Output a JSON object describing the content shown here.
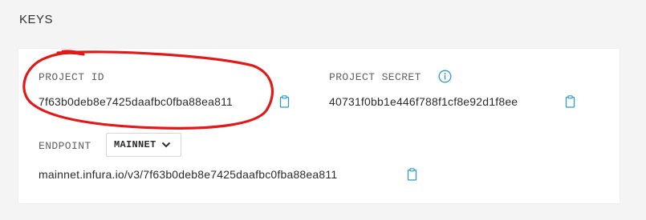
{
  "section": {
    "title": "KEYS"
  },
  "project_id": {
    "label": "PROJECT ID",
    "value": "7f63b0deb8e7425daafbc0fba88ea811"
  },
  "project_secret": {
    "label": "PROJECT SECRET",
    "value": "40731f0bb1e446f788f1cf8e92d1f8ee"
  },
  "endpoint": {
    "label": "ENDPOINT",
    "network": "MAINNET",
    "url": "mainnet.infura.io/v3/7f63b0deb8e7425daafbc0fba88ea811"
  },
  "icons": {
    "copy": "clipboard-icon",
    "info": "info-icon",
    "dropdown": "chevron-down-icon"
  },
  "colors": {
    "accent": "#2e9ac8",
    "annotation": "#e01919",
    "background": "#f4f4f4",
    "card": "#ffffff"
  }
}
